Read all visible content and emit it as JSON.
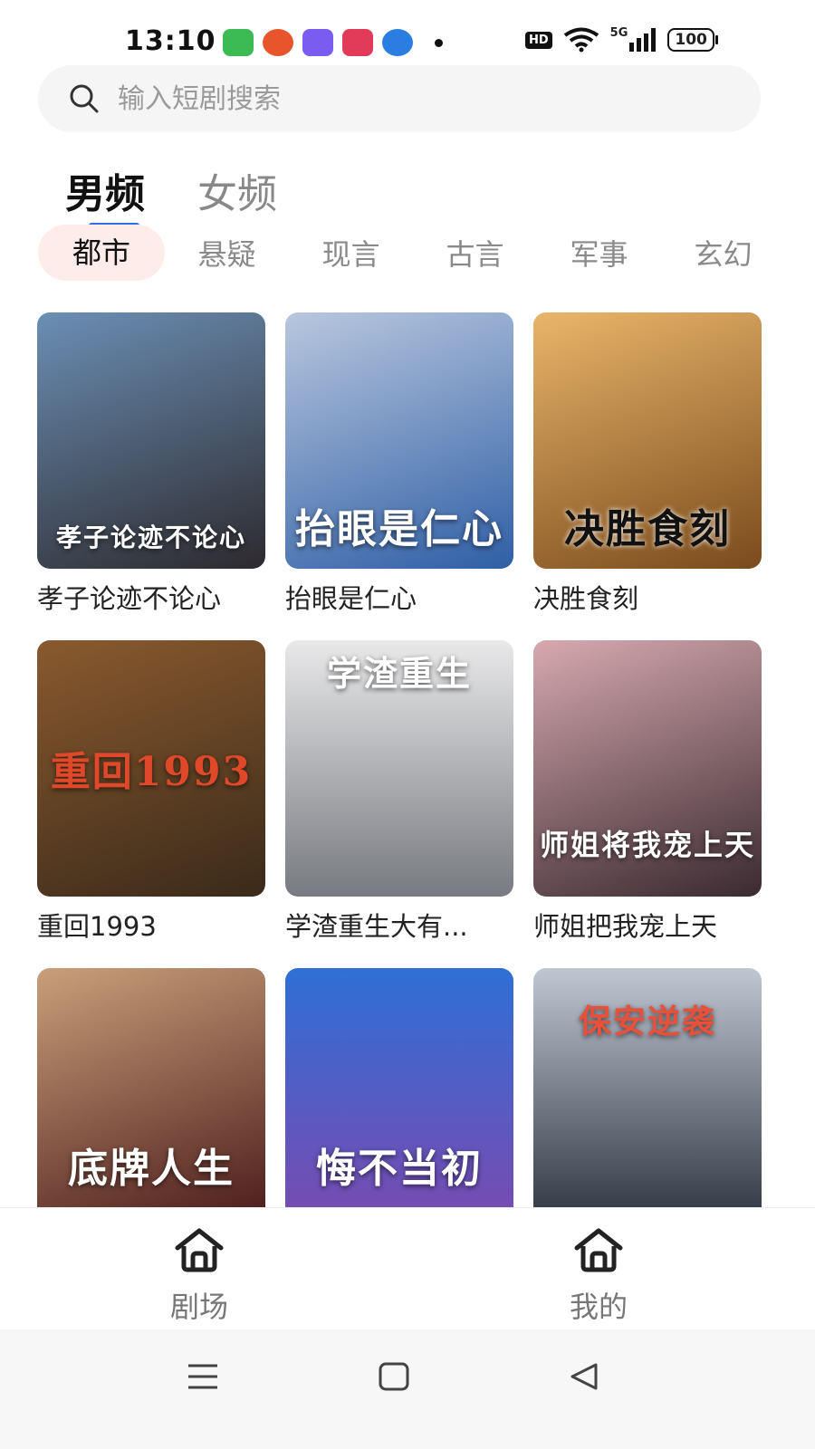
{
  "status_bar": {
    "time": "13:10",
    "hd": "HD",
    "network": "5G",
    "battery": "100",
    "app_icon_colors": [
      "#3cba54",
      "#e8542b",
      "#7a5cf0",
      "#e23b5a",
      "#2a7de1"
    ]
  },
  "search": {
    "placeholder": "输入短剧搜索"
  },
  "primary_tabs": [
    {
      "label": "男频",
      "active": true
    },
    {
      "label": "女频",
      "active": false
    }
  ],
  "categories": [
    {
      "label": "都市",
      "active": true
    },
    {
      "label": "悬疑"
    },
    {
      "label": "现言"
    },
    {
      "label": "古言"
    },
    {
      "label": "军事"
    },
    {
      "label": "玄幻"
    }
  ],
  "dramas": [
    {
      "title": "孝子论迹不论心",
      "poster_text": "孝子论迹不论心",
      "colors": [
        "#6b8fb5",
        "#2d2a2e"
      ]
    },
    {
      "title": "抬眼是仁心",
      "poster_text": "抬眼是仁心",
      "colors": [
        "#2f5fa6",
        "#b9c7de"
      ]
    },
    {
      "title": "决胜食刻",
      "poster_text": "决胜食刻",
      "colors": [
        "#e8b66a",
        "#7a4a1c"
      ]
    },
    {
      "title": "重回1993",
      "poster_text": "重回1993",
      "colors": [
        "#8a5a2e",
        "#3a2a1a"
      ]
    },
    {
      "title": "学渣重生大有...",
      "poster_text": "学渣重生",
      "colors": [
        "#e9e9ea",
        "#777a80"
      ]
    },
    {
      "title": "师姐把我宠上天",
      "poster_text": "师姐将我宠上天",
      "colors": [
        "#d7a9b0",
        "#3a2a30"
      ]
    },
    {
      "title": "",
      "poster_text": "底牌人生",
      "colors": [
        "#c9a07a",
        "#4a1a1a"
      ]
    },
    {
      "title": "",
      "poster_text": "悔不当初",
      "colors": [
        "#2f6fd6",
        "#e8b73a"
      ]
    },
    {
      "title": "",
      "poster_text": "保安逆袭",
      "colors": [
        "#bfc7d2",
        "#2e3440"
      ]
    }
  ],
  "bottom_nav": [
    {
      "label": "剧场",
      "icon": "home-icon"
    },
    {
      "label": "我的",
      "icon": "home-icon"
    }
  ],
  "system_nav": [
    "menu-icon",
    "home-square-icon",
    "back-triangle-icon"
  ]
}
